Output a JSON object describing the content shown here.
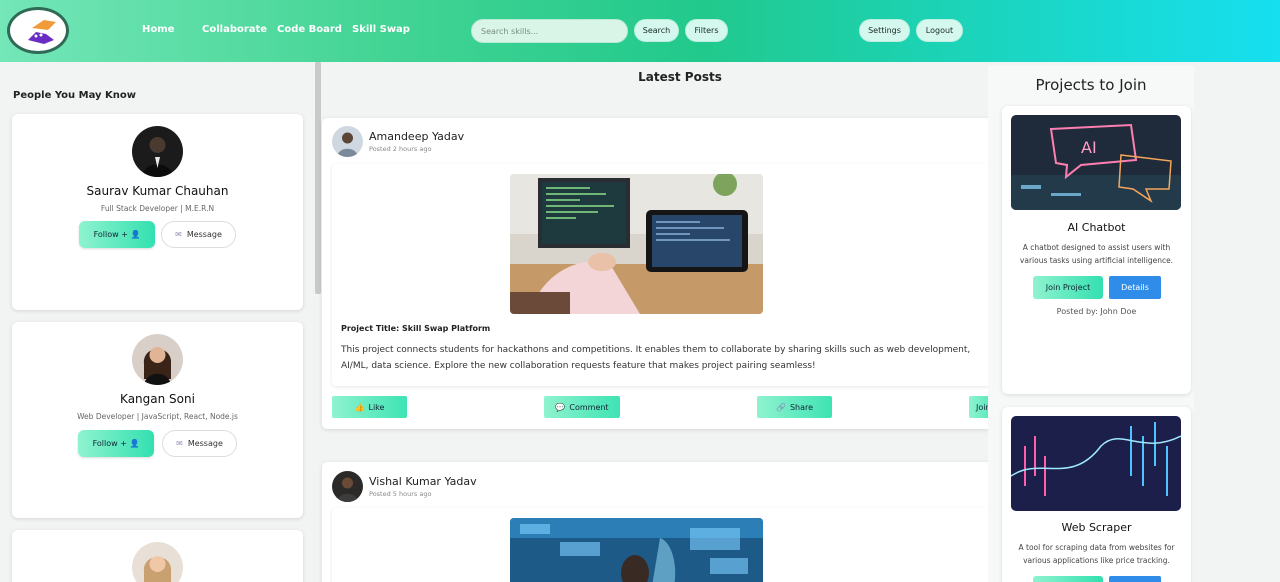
{
  "nav": {
    "links": [
      "Home",
      "Collaborate",
      "Code Board",
      "Skill Swap"
    ],
    "search_placeholder": "Search skills...",
    "search_button": "Search",
    "filters_button": "Filters",
    "settings_button": "Settings",
    "logout_button": "Logout"
  },
  "sidebar": {
    "title": "People You May Know",
    "people": [
      {
        "name": "Saurav Kumar Chauhan",
        "role": "Full Stack Developer | M.E.R.N",
        "follow": "Follow + 👤",
        "message": "Message"
      },
      {
        "name": "Kangan Soni",
        "role": "Web Developer | JavaScript, React, Node.js",
        "follow": "Follow + 👤",
        "message": "Message"
      }
    ]
  },
  "feed": {
    "title": "Latest Posts",
    "posts": [
      {
        "author": "Amandeep Yadav",
        "time": "Posted 2 hours ago",
        "project_title": "Project Title: Skill Swap Platform",
        "description": "This project connects students for hackathons and competitions. It enables them to collaborate by sharing skills such as web development, AI/ML, data science. Explore the new collaboration requests feature that makes project pairing seamless!",
        "actions": {
          "like": "Like",
          "comment": "Comment",
          "share": "Share",
          "join": "Join"
        }
      },
      {
        "author": "Vishal Kumar Yadav",
        "time": "Posted 5 hours ago"
      }
    ]
  },
  "projects": {
    "title": "Projects to Join",
    "items": [
      {
        "name": "AI Chatbot",
        "description": "A chatbot designed to assist users with various tasks using artificial intelligence.",
        "join": "Join Project",
        "details": "Details",
        "posted_by": "Posted by: John Doe"
      },
      {
        "name": "Web Scraper",
        "description": "A tool for scraping data from websites for various applications like price tracking."
      }
    ]
  },
  "colors": {
    "accent": "#33e0b0",
    "details_blue": "#2f8de9",
    "nav_gradient_start": "#74e6b8",
    "nav_gradient_end": "#16dff0"
  },
  "icons": [
    "logo-handshake-icon",
    "user-plus-icon",
    "envelope-icon",
    "thumbs-up-icon",
    "comment-icon",
    "link-icon"
  ]
}
